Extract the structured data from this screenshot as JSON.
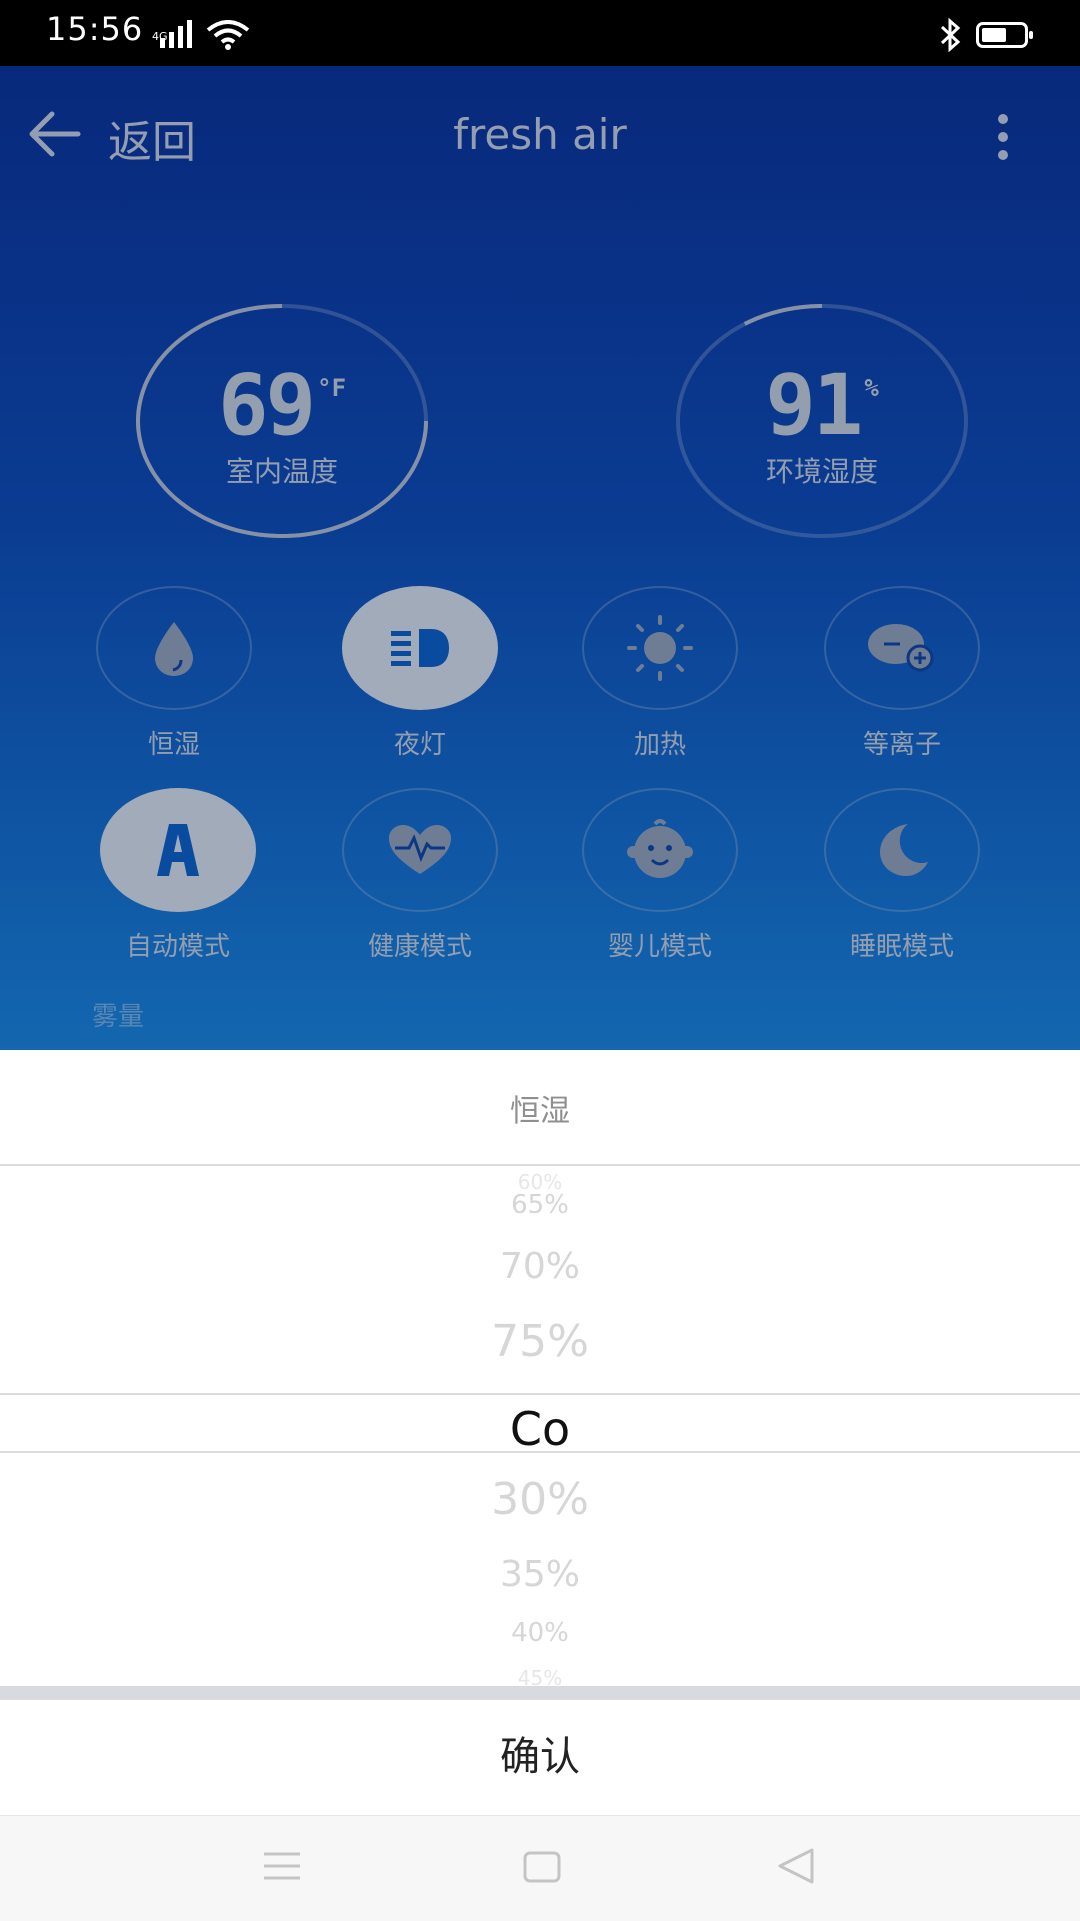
{
  "status_bar": {
    "time": "15:56",
    "network": "4G",
    "icons": [
      "signal-icon",
      "wifi-icon",
      "bluetooth-icon",
      "battery-icon"
    ]
  },
  "header": {
    "back_label": "返回",
    "title": "fresh air",
    "more_icon": "more-vertical-icon"
  },
  "gauges": [
    {
      "value": "69",
      "unit": "°F",
      "label": "室内温度",
      "fill_fraction": 0.25
    },
    {
      "value": "91",
      "unit": "%",
      "label": "环境湿度",
      "fill_fraction": 0.91
    }
  ],
  "modes": [
    {
      "label": "恒湿",
      "icon": "water-drop-icon",
      "active": false
    },
    {
      "label": "夜灯",
      "icon": "night-light-icon",
      "active": true
    },
    {
      "label": "加热",
      "icon": "sun-icon",
      "active": false
    },
    {
      "label": "等离子",
      "icon": "plasma-icon",
      "active": false
    },
    {
      "label": "自动模式",
      "icon": "auto-mode-icon",
      "active": true
    },
    {
      "label": "健康模式",
      "icon": "heart-pulse-icon",
      "active": false
    },
    {
      "label": "婴儿模式",
      "icon": "baby-face-icon",
      "active": false
    },
    {
      "label": "睡眠模式",
      "icon": "moon-icon",
      "active": false
    }
  ],
  "mist_label": "雾量",
  "picker": {
    "title": "恒湿",
    "above": [
      "60%",
      "65%",
      "70%",
      "75%"
    ],
    "selected": "Co",
    "below": [
      "30%",
      "35%",
      "40%",
      "45%"
    ],
    "confirm_label": "确认"
  },
  "nav_bar": {
    "icons": [
      "menu-icon",
      "home-icon",
      "back-triangle-icon"
    ]
  },
  "colors": {
    "app_bg_top": "#0a2f8d",
    "app_bg_bottom": "#1675c8",
    "active_button": "#b9c3d4",
    "accent_icon": "#0b57b5"
  }
}
